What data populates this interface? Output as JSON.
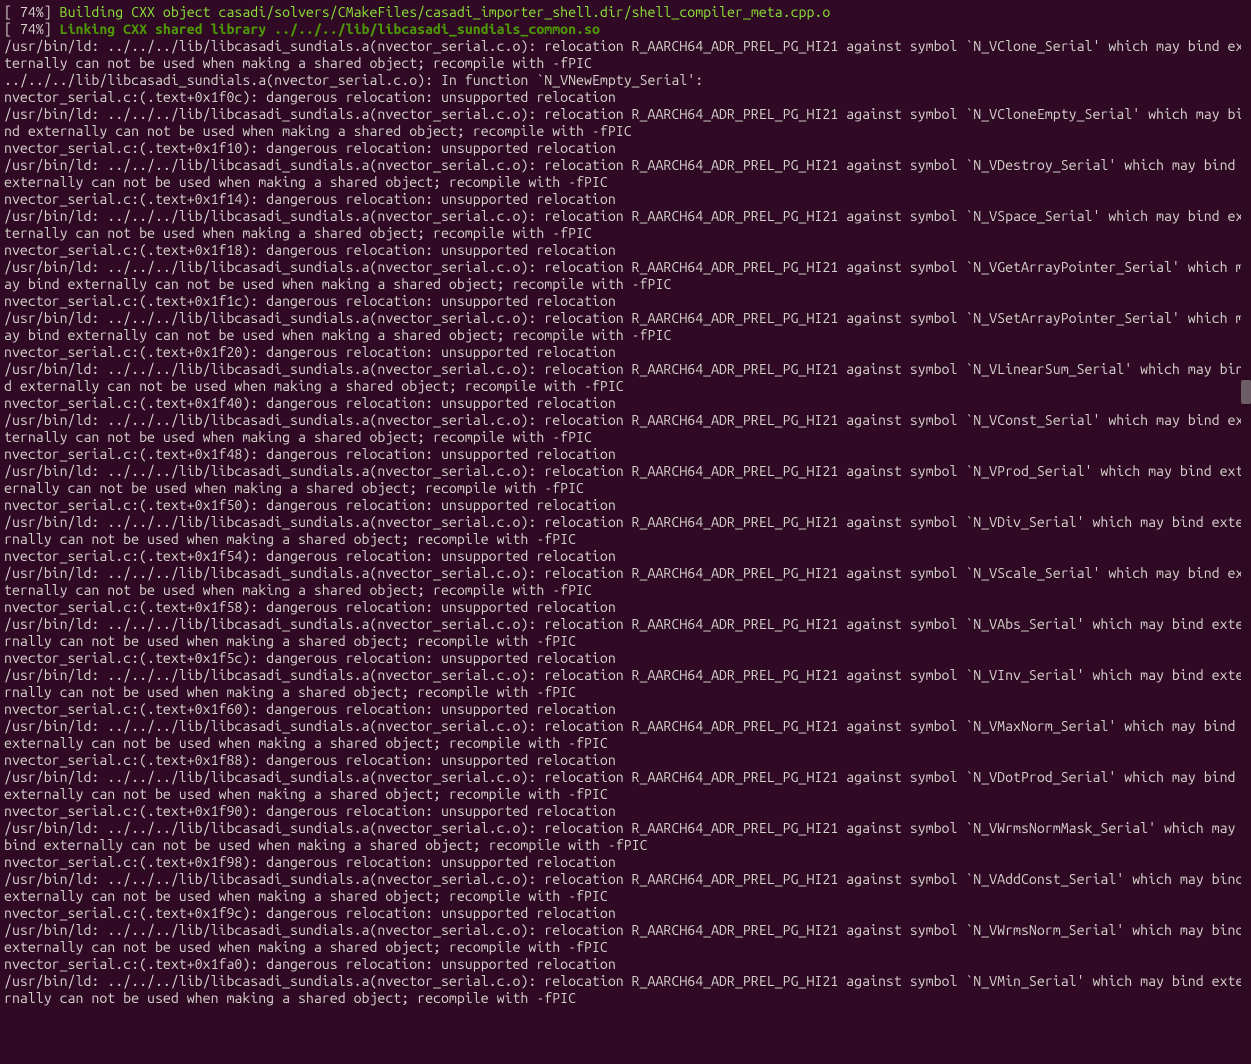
{
  "progress_prefix": "[ 74%] ",
  "build_line": "Building CXX object casadi/solvers/CMakeFiles/casadi_importer_shell.dir/shell_compiler_meta.cpp.o",
  "link_line": "Linking CXX shared library ../../../lib/libcasadi_sundials_common.so",
  "ld_prefix": "/usr/bin/ld: ../../../lib/libcasadi_sundials.a(nvector_serial.c.o): relocation R_AARCH64_ADR_PREL_PG_HI21 against symbol `",
  "in_function_line": "../../../lib/libcasadi_sundials.a(nvector_serial.c.o): In function `N_VNewEmpty_Serial':",
  "cont_suffix": "' which may bind externally can not be used when making a shared object; recompile with -fPIC",
  "cont_suffix_nospace": " which may bind externally can not be used when making a shared object; recompile with -fPIC",
  "dang_prefix": "nvector_serial.c:(.text+0x",
  "dang_suffix": "): dangerous relocation: unsupported relocation",
  "errors": [
    {
      "symbol": "N_VClone_Serial",
      "offset": "1f0c",
      "wrap_after": "N_VClone_Serial"
    },
    {
      "symbol": "N_VCloneEmpty_Serial",
      "offset": "1f10",
      "wrap_after": "N_VCloneEmpty_S"
    },
    {
      "symbol": "N_VDestroy_Serial",
      "offset": "1f14",
      "wrap_after": "N_VDestroy_Seri"
    },
    {
      "symbol": "N_VSpace_Serial",
      "offset": "1f18",
      "wrap_after": "N_VSpace_Serial"
    },
    {
      "symbol": "N_VGetArrayPointer_Serial",
      "offset": "1f1c",
      "wrap_after": "N_VGetArrayPoin"
    },
    {
      "symbol": "N_VSetArrayPointer_Serial",
      "offset": "1f20",
      "wrap_after": "N_VSetArrayPoin"
    },
    {
      "symbol": "N_VLinearSum_Serial",
      "offset": "1f40",
      "wrap_after": "N_VLinearSum_Se"
    },
    {
      "symbol": "N_VConst_Serial",
      "offset": "1f48",
      "wrap_after": "N_VConst_Serial"
    },
    {
      "symbol": "N_VProd_Serial",
      "offset": "1f50",
      "wrap_after": "N_VProd_Serial'",
      "nospace": true
    },
    {
      "symbol": "N_VDiv_Serial",
      "offset": "1f54",
      "wrap_after": "N_VDiv_Serial' ",
      "nowrap": true
    },
    {
      "symbol": "N_VScale_Serial",
      "offset": "1f58",
      "wrap_after": "N_VScale_Serial"
    },
    {
      "symbol": "N_VAbs_Serial",
      "offset": "1f5c",
      "wrap_after": "N_VAbs_Serial' ",
      "nowrap": true
    },
    {
      "symbol": "N_VInv_Serial",
      "offset": "1f60",
      "wrap_after": "N_VInv_Serial' ",
      "nowrap": true
    },
    {
      "symbol": "N_VMaxNorm_Serial",
      "offset": "1f88",
      "wrap_after": "N_VMaxNorm_Seri"
    },
    {
      "symbol": "N_VDotProd_Serial",
      "offset": "1f90",
      "wrap_after": "N_VDotProd_Seri"
    },
    {
      "symbol": "N_VWrmsNormMask_Serial",
      "offset": "1f98",
      "wrap_after": "N_VWrmsNormMask"
    },
    {
      "symbol": "N_VAddConst_Serial",
      "offset": "1f9c",
      "wrap_after": "N_VAddConst_Ser"
    },
    {
      "symbol": "N_VWrmsNorm_Serial",
      "offset": "1fa0",
      "wrap_after": "N_VWrmsNorm_Ser"
    },
    {
      "symbol": "N_VMin_Serial",
      "offset": "",
      "wrap_after": "N_VMin_Serial' ",
      "nowrap": true,
      "last": true
    }
  ]
}
